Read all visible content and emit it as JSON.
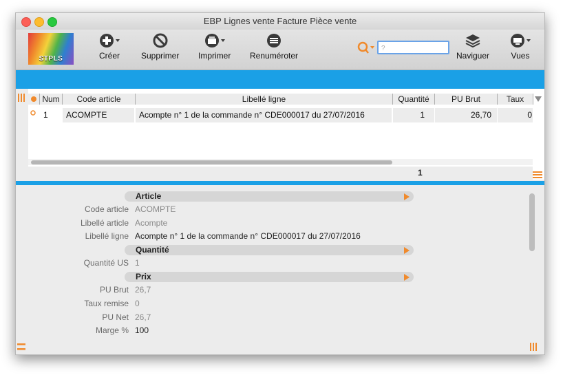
{
  "window": {
    "title": "EBP Lignes vente Facture Pièce vente"
  },
  "logo": {
    "text": "STPLS"
  },
  "toolbar": {
    "creer": "Créer",
    "supprimer": "Supprimer",
    "imprimer": "Imprimer",
    "renumeroter": "Renuméroter",
    "naviguer": "Naviguer",
    "vues": "Vues",
    "search_placeholder": "?"
  },
  "grid": {
    "headers": {
      "num": "Num",
      "code": "Code article",
      "libelle": "Libellé ligne",
      "quantite": "Quantité",
      "pu_brut": "PU Brut",
      "taux": "Taux"
    },
    "row": {
      "num": "1",
      "code": "ACOMPTE",
      "libelle": "Acompte n° 1 de la commande n° CDE000017 du 27/07/2016",
      "quantite": "1",
      "pu_brut": "26,70",
      "taux": "0"
    },
    "footer_quantite": "1"
  },
  "detail": {
    "sections": {
      "article": "Article",
      "quantite": "Quantité",
      "prix": "Prix"
    },
    "fields": {
      "code_article": {
        "label": "Code article",
        "value": "ACOMPTE"
      },
      "libelle_article": {
        "label": "Libellé article",
        "value": "Acompte"
      },
      "libelle_ligne": {
        "label": "Libellé ligne",
        "value": "Acompte n° 1 de la commande n° CDE000017 du 27/07/2016"
      },
      "quantite_us": {
        "label": "Quantité US",
        "value": "1"
      },
      "pu_brut": {
        "label": "PU Brut",
        "value": "26,7"
      },
      "taux_remise": {
        "label": "Taux remise",
        "value": "0"
      },
      "pu_net": {
        "label": "PU Net",
        "value": "26,7"
      },
      "marge": {
        "label": "Marge %",
        "value": "100"
      }
    }
  },
  "colors": {
    "accent_blue": "#1aa0e6",
    "accent_orange": "#f08a2c"
  }
}
